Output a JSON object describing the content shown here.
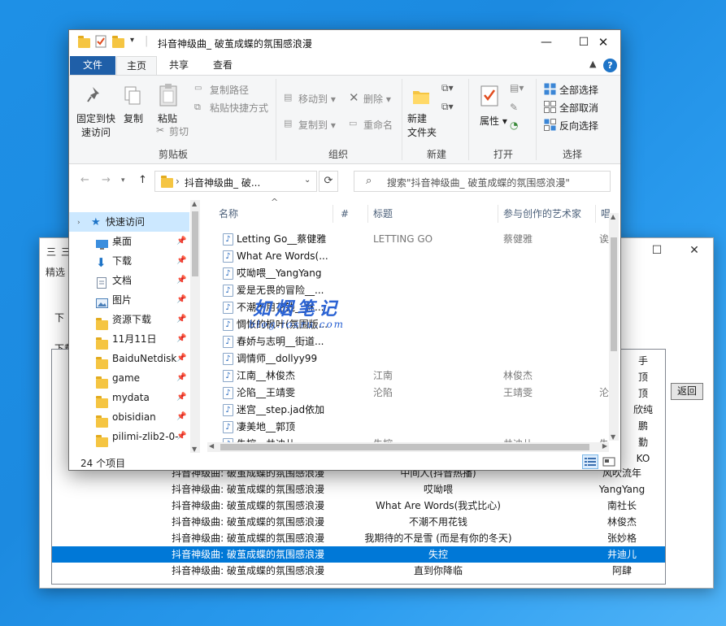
{
  "bgwindow": {
    "title_char": "三",
    "menu": "精选",
    "side_label_1": "下",
    "side_label_2": "下载",
    "back_button": "返回",
    "minimize_glyph": "—",
    "maximize_glyph": "☐",
    "close_glyph": "✕",
    "artist_peek": [
      "手",
      "顶",
      "顶",
      "欣纯",
      "鹏",
      "勤",
      "KO"
    ],
    "rows": [
      {
        "album": "抖音神级曲: 破茧成蝶的氛围感浪漫",
        "title": "中间人(抖音热播)",
        "artist": "风吹流年",
        "selected": false
      },
      {
        "album": "抖音神级曲: 破茧成蝶的氛围感浪漫",
        "title": "哎呦喂",
        "artist": "YangYang",
        "selected": false
      },
      {
        "album": "抖音神级曲: 破茧成蝶的氛围感浪漫",
        "title": "What Are Words(我式比心)",
        "artist": "南社长",
        "selected": false
      },
      {
        "album": "抖音神级曲: 破茧成蝶的氛围感浪漫",
        "title": "不潮不用花钱",
        "artist": "林俊杰",
        "selected": false
      },
      {
        "album": "抖音神级曲: 破茧成蝶的氛围感浪漫",
        "title": "我期待的不是雪 (而是有你的冬天)",
        "artist": "张妙格",
        "selected": false
      },
      {
        "album": "抖音神级曲: 破茧成蝶的氛围感浪漫",
        "title": "失控",
        "artist": "井迪儿",
        "selected": true
      },
      {
        "album": "抖音神级曲: 破茧成蝶的氛围感浪漫",
        "title": "直到你降临",
        "artist": "阿肆",
        "selected": false
      }
    ]
  },
  "explorer": {
    "title": "抖音神级曲_ 破茧成蝶的氛围感浪漫",
    "window": {
      "minimize": "—",
      "maximize": "☐",
      "close": "✕"
    },
    "tabs": {
      "file": "文件",
      "home": "主页",
      "share": "共享",
      "view": "查看"
    },
    "ribbon": {
      "pin_quick_access": "固定到快",
      "pin_quick_access_2": "速访问",
      "copy": "复制",
      "paste": "粘贴",
      "copy_path": "复制路径",
      "paste_shortcut": "粘贴快捷方式",
      "cut": "剪切",
      "group_clipboard": "剪贴板",
      "move_to": "移动到",
      "copy_to": "复制到",
      "delete": "删除",
      "rename": "重命名",
      "group_organize": "组织",
      "new_folder": "新建",
      "new_folder_2": "文件夹",
      "group_new": "新建",
      "properties": "属性",
      "group_open": "打开",
      "select_all": "全部选择",
      "select_none": "全部取消",
      "invert_selection": "反向选择",
      "group_select": "选择"
    },
    "address": {
      "crumb": "抖音神级曲_ 破...",
      "search_placeholder": "搜索\"抖音神级曲_ 破茧成蝶的氛围感浪漫\""
    },
    "nav": [
      {
        "label": "快速访问",
        "pinned": false,
        "selected": true
      },
      {
        "label": "桌面",
        "pinned": true
      },
      {
        "label": "下载",
        "pinned": true
      },
      {
        "label": "文档",
        "pinned": true
      },
      {
        "label": "图片",
        "pinned": true
      },
      {
        "label": "资源下载",
        "pinned": true
      },
      {
        "label": "11月11日",
        "pinned": true
      },
      {
        "label": "BaiduNetdisk",
        "pinned": true
      },
      {
        "label": "game",
        "pinned": true
      },
      {
        "label": "mydata",
        "pinned": true
      },
      {
        "label": "obisidian",
        "pinned": true
      },
      {
        "label": "pilimi-zlib2-0-",
        "pinned": true
      }
    ],
    "columns": {
      "name": "名称",
      "num": "#",
      "title": "标题",
      "artist": "参与创作的艺术家",
      "extra": "唱"
    },
    "files": [
      {
        "name": "Letting Go__蔡健雅",
        "title": "LETTING GO",
        "artist": "蔡健雅",
        "extra": "诶"
      },
      {
        "name": "What Are Words(...",
        "title": "",
        "artist": "",
        "extra": ""
      },
      {
        "name": "哎呦喂__YangYang",
        "title": "",
        "artist": "",
        "extra": ""
      },
      {
        "name": "爱是无畏的冒险__...",
        "title": "",
        "artist": "",
        "extra": ""
      },
      {
        "name": "不潮不用花钱__林...",
        "title": "",
        "artist": "",
        "extra": ""
      },
      {
        "name": "惆怅的枫叶(氛围版...",
        "title": "",
        "artist": "",
        "extra": ""
      },
      {
        "name": "春娇与志明__街道...",
        "title": "",
        "artist": "",
        "extra": ""
      },
      {
        "name": "调情师__dollyy99",
        "title": "",
        "artist": "",
        "extra": ""
      },
      {
        "name": "江南__林俊杰",
        "title": "江南",
        "artist": "林俊杰",
        "extra": ""
      },
      {
        "name": "沦陷__王靖雯",
        "title": "沦陷",
        "artist": "王靖雯",
        "extra": "沦"
      },
      {
        "name": "迷宫__step.jad依加",
        "title": "",
        "artist": "",
        "extra": ""
      },
      {
        "name": "凄美地__郭顶",
        "title": "",
        "artist": "",
        "extra": ""
      },
      {
        "name": "失控__井迪儿",
        "title": "失控",
        "artist": "井迪儿",
        "extra": "失"
      }
    ],
    "status": "24 个项目"
  },
  "watermark": {
    "line1": "如烟笔记",
    "line2": "blog.iosru.com"
  },
  "colors": {
    "accent": "#0078d7",
    "file_tab": "#1f5fa8",
    "folder": "#f5c542"
  }
}
